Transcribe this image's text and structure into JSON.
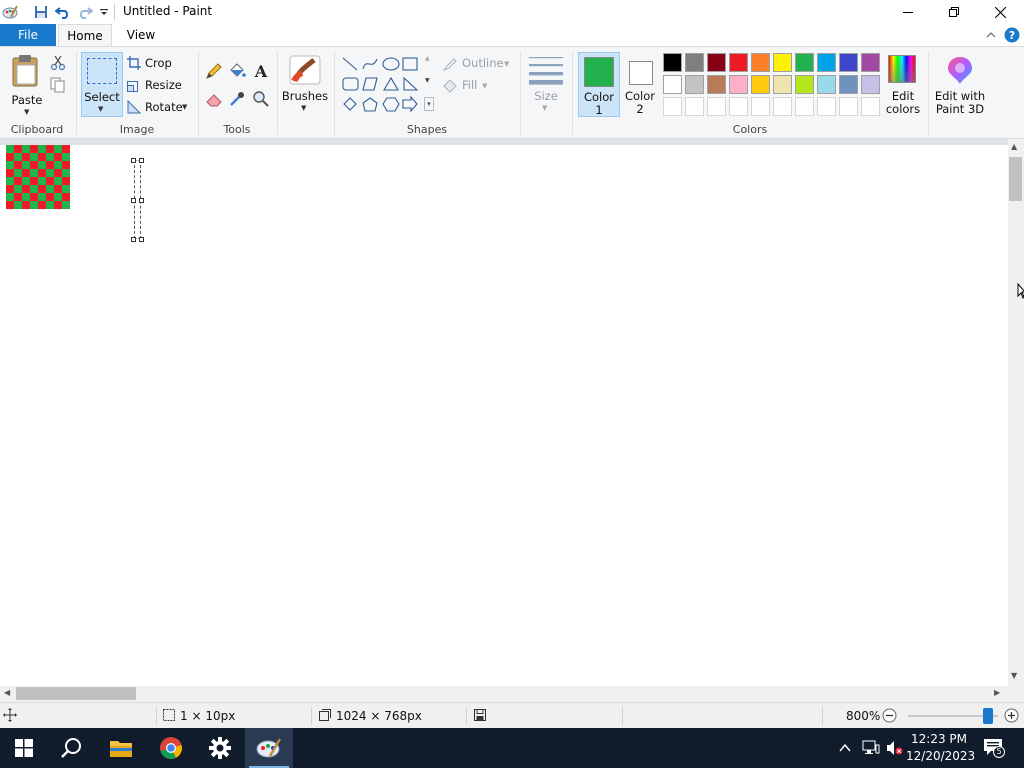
{
  "window": {
    "title": "Untitled - Paint"
  },
  "tabs": {
    "file": "File",
    "home": "Home",
    "view": "View"
  },
  "ribbon": {
    "clipboard": {
      "paste": "Paste",
      "group": "Clipboard"
    },
    "image": {
      "select": "Select",
      "crop": "Crop",
      "resize": "Resize",
      "rotate": "Rotate",
      "group": "Image"
    },
    "tools": {
      "group": "Tools"
    },
    "brushes": {
      "label": "Brushes"
    },
    "shapes": {
      "outline": "Outline",
      "fill": "Fill",
      "group": "Shapes"
    },
    "size": {
      "label": "Size"
    },
    "colors": {
      "color1": "Color\n1",
      "color1_a": "Color",
      "color1_b": "1",
      "color2_a": "Color",
      "color2_b": "2",
      "edit_a": "Edit",
      "edit_b": "colors",
      "group": "Colors",
      "color1_value": "#22b14c",
      "color2_value": "#ffffff",
      "palette_row1": [
        "#000000",
        "#7f7f7f",
        "#880015",
        "#ed1c24",
        "#ff7f27",
        "#fff200",
        "#22b14c",
        "#00a2e8",
        "#3f48cc",
        "#a349a4"
      ],
      "palette_row2": [
        "#ffffff",
        "#c3c3c3",
        "#b97a57",
        "#ffaec9",
        "#ffc90e",
        "#efe4b0",
        "#b5e61d",
        "#99d9ea",
        "#7092be",
        "#c8bfe7"
      ]
    },
    "paint3d": {
      "line1": "Edit with",
      "line2": "Paint 3D"
    }
  },
  "canvas": {
    "pattern_colors": [
      "#22b14c",
      "#ed1c24"
    ]
  },
  "statusbar": {
    "selection_size": "1 × 10px",
    "image_size": "1024 × 768px",
    "zoom": "800%",
    "zoom_level": 0.89
  },
  "taskbar": {
    "time": "12:23 PM",
    "date": "12/20/2023",
    "notifications": "5"
  }
}
